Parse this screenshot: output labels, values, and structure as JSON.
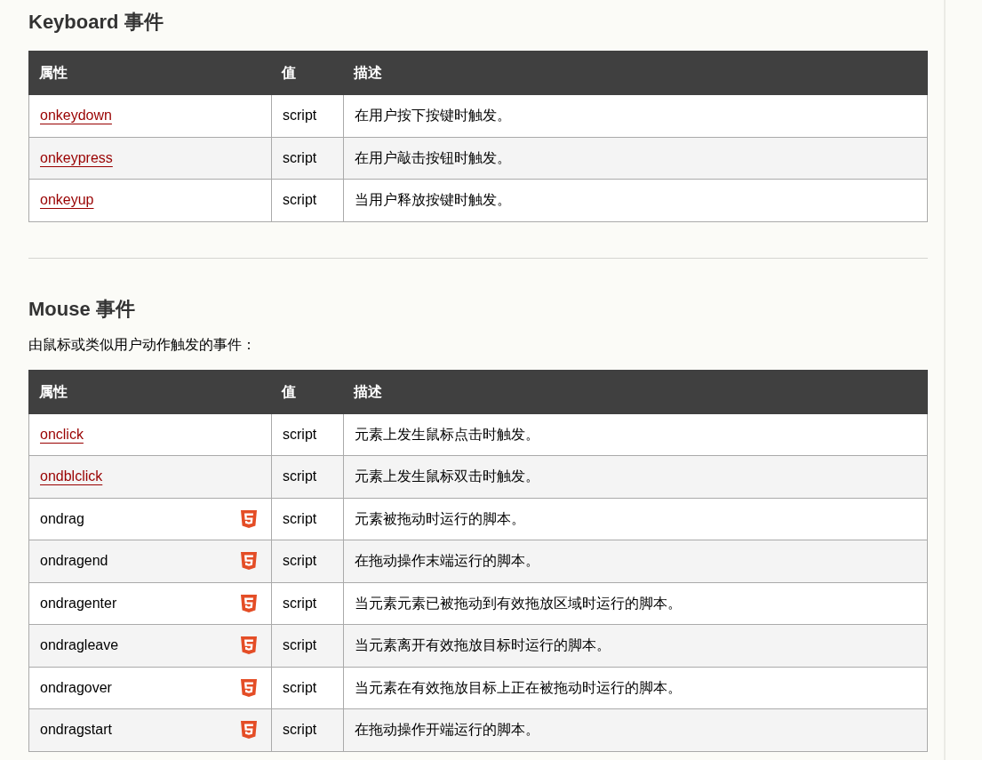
{
  "sections": [
    {
      "title": "Keyboard 事件",
      "table": {
        "columns": [
          "属性",
          "值",
          "描述"
        ],
        "rows": [
          {
            "kind": "link",
            "name": "onkeydown",
            "value": "script",
            "description": "在用户按下按键时触发。"
          },
          {
            "kind": "link",
            "name": "onkeypress",
            "value": "script",
            "description": "在用户敲击按钮时触发。"
          },
          {
            "kind": "link",
            "name": "onkeyup",
            "value": "script",
            "description": "当用户释放按键时触发。"
          }
        ]
      }
    },
    {
      "title": "Mouse 事件",
      "intro": "由鼠标或类似用户动作触发的事件：",
      "table": {
        "columns": [
          "属性",
          "值",
          "描述"
        ],
        "rows": [
          {
            "kind": "link",
            "name": "onclick",
            "value": "script",
            "description": "元素上发生鼠标点击时触发。"
          },
          {
            "kind": "link",
            "name": "ondblclick",
            "value": "script",
            "description": "元素上发生鼠标双击时触发。"
          },
          {
            "kind": "html5",
            "name": "ondrag",
            "value": "script",
            "description": "元素被拖动时运行的脚本。"
          },
          {
            "kind": "html5",
            "name": "ondragend",
            "value": "script",
            "description": "在拖动操作末端运行的脚本。"
          },
          {
            "kind": "html5",
            "name": "ondragenter",
            "value": "script",
            "description": "当元素元素已被拖动到有效拖放区域时运行的脚本。"
          },
          {
            "kind": "html5",
            "name": "ondragleave",
            "value": "script",
            "description": "当元素离开有效拖放目标时运行的脚本。"
          },
          {
            "kind": "html5",
            "name": "ondragover",
            "value": "script",
            "description": "当元素在有效拖放目标上正在被拖动时运行的脚本。"
          },
          {
            "kind": "html5",
            "name": "ondragstart",
            "value": "script",
            "description": "在拖动操作开端运行的脚本。"
          }
        ]
      }
    }
  ]
}
